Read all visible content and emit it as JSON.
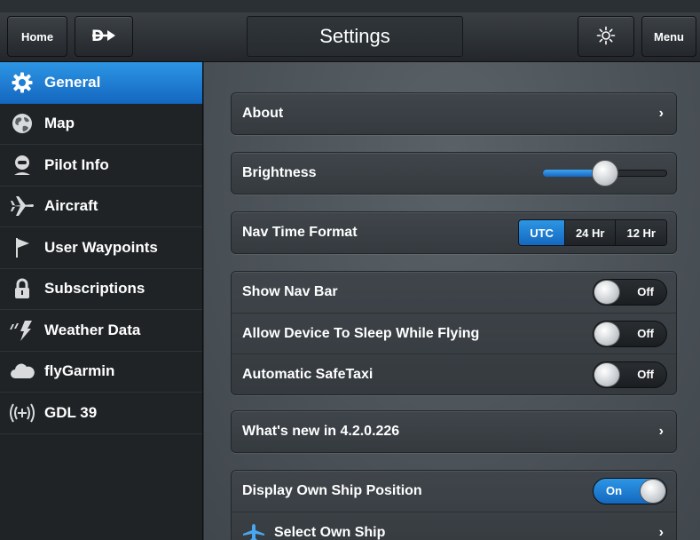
{
  "topbar": {
    "home_label": "Home",
    "direct_to_icon": "direct-to-icon",
    "title": "Settings",
    "brightness_icon": "brightness-icon",
    "menu_label": "Menu"
  },
  "sidebar": {
    "items": [
      {
        "label": "General",
        "icon": "gear-icon",
        "active": true
      },
      {
        "label": "Map",
        "icon": "globe-icon"
      },
      {
        "label": "Pilot Info",
        "icon": "pilot-icon"
      },
      {
        "label": "Aircraft",
        "icon": "airplane-icon"
      },
      {
        "label": "User Waypoints",
        "icon": "flag-icon"
      },
      {
        "label": "Subscriptions",
        "icon": "lock-icon"
      },
      {
        "label": "Weather Data",
        "icon": "lightning-icon"
      },
      {
        "label": "flyGarmin",
        "icon": "cloud-icon"
      },
      {
        "label": "GDL 39",
        "icon": "wireless-icon"
      }
    ]
  },
  "settings": {
    "about": "About",
    "brightness": {
      "label": "Brightness",
      "level": 0.5
    },
    "nav_time_format": {
      "label": "Nav Time Format",
      "options": [
        "UTC",
        "24 Hr",
        "12 Hr"
      ],
      "selected": "UTC"
    },
    "show_nav_bar": {
      "label": "Show Nav Bar",
      "state": "Off"
    },
    "allow_sleep": {
      "label": "Allow Device To Sleep While Flying",
      "state": "Off"
    },
    "auto_safetaxi": {
      "label": "Automatic SafeTaxi",
      "state": "Off"
    },
    "whats_new": "What's new in 4.2.0.226",
    "display_own_ship": {
      "label": "Display Own Ship Position",
      "state": "On"
    },
    "select_own_ship": "Select Own Ship"
  },
  "colors": {
    "accent_blue": "#1e7fd6",
    "panel": "#3a4045",
    "sidebar": "#1f2326"
  }
}
